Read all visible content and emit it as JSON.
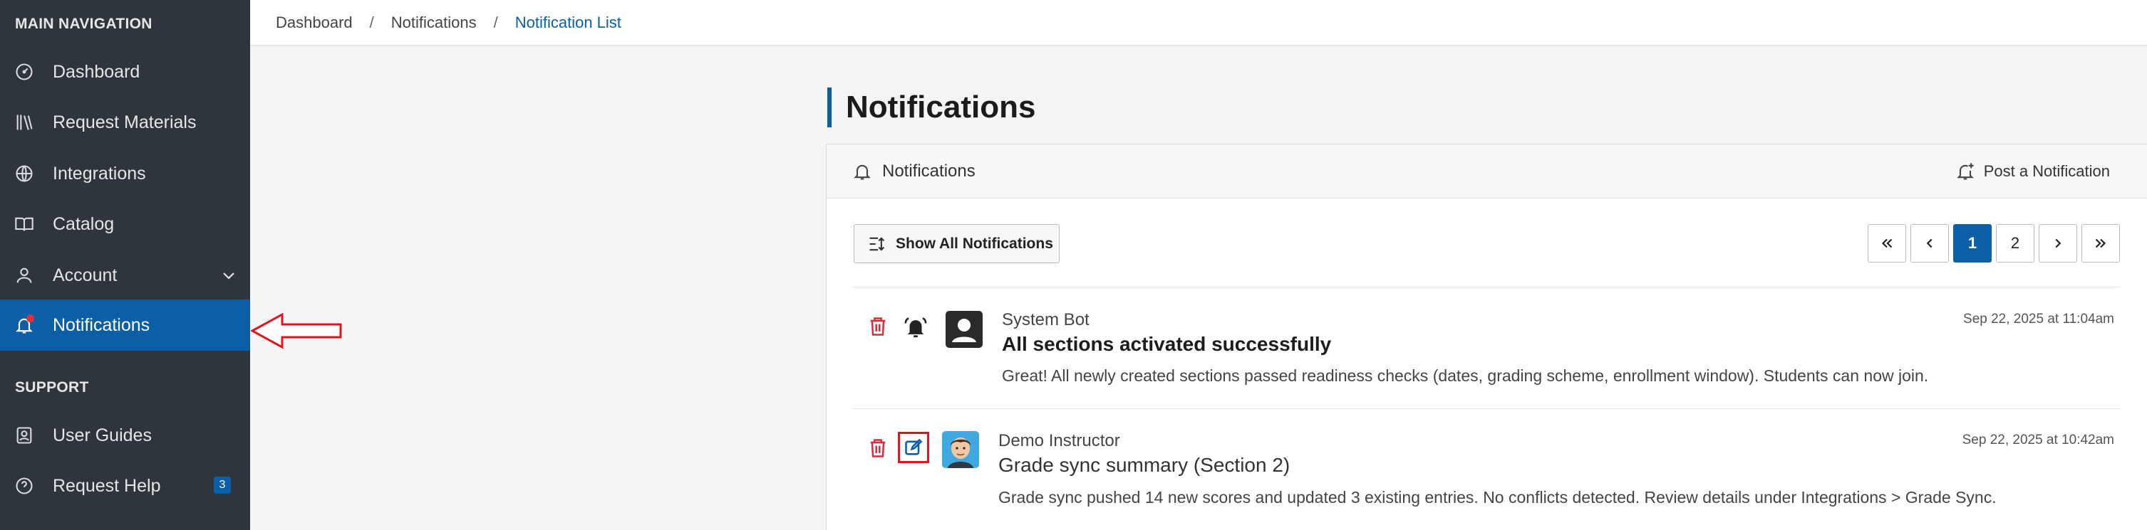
{
  "sidebar": {
    "main_heading": "MAIN NAVIGATION",
    "items": [
      {
        "label": "Dashboard",
        "icon": "gauge-icon"
      },
      {
        "label": "Request Materials",
        "icon": "books-icon"
      },
      {
        "label": "Integrations",
        "icon": "globe-icon"
      },
      {
        "label": "Catalog",
        "icon": "book-open-icon"
      },
      {
        "label": "Account",
        "icon": "user-icon"
      },
      {
        "label": "Notifications",
        "icon": "bell-icon",
        "active": true
      }
    ],
    "support_heading": "SUPPORT",
    "support_items": [
      {
        "label": "User Guides",
        "icon": "guide-icon"
      },
      {
        "label": "Request Help",
        "icon": "help-icon",
        "badge": "3"
      }
    ]
  },
  "breadcrumb": {
    "items": [
      "Dashboard",
      "Notifications",
      "Notification List"
    ],
    "separator": "/"
  },
  "page": {
    "title": "Notifications"
  },
  "card": {
    "header_label": "Notifications",
    "post_label": "Post a Notification",
    "show_all_label": "Show All Notifications"
  },
  "pagination": {
    "pages": [
      "1",
      "2"
    ],
    "current": "1"
  },
  "notifications": [
    {
      "sender": "System Bot",
      "subject": "All sections activated successfully",
      "body": "Great! All newly created sections passed readiness checks (dates, grading scheme, enrollment window). Students can now join.",
      "timestamp": "Sep 22, 2025 at 11:04am",
      "type_icon": "bell-ring-icon",
      "avatar": "user-square-icon"
    },
    {
      "sender": "Demo Instructor",
      "subject": "Grade sync summary (Section 2)",
      "body": "Grade sync pushed 14 new scores and updated 3 existing entries. No conflicts detected. Review details under Integrations > Grade Sync.",
      "timestamp": "Sep 22, 2025 at 10:42am",
      "type_icon": "edit-icon",
      "avatar": "instructor-avatar"
    }
  ],
  "colors": {
    "sidebar_bg": "#2f353d",
    "accent": "#0b5fa6",
    "danger": "#d1313c",
    "annotation": "#e0151f"
  }
}
